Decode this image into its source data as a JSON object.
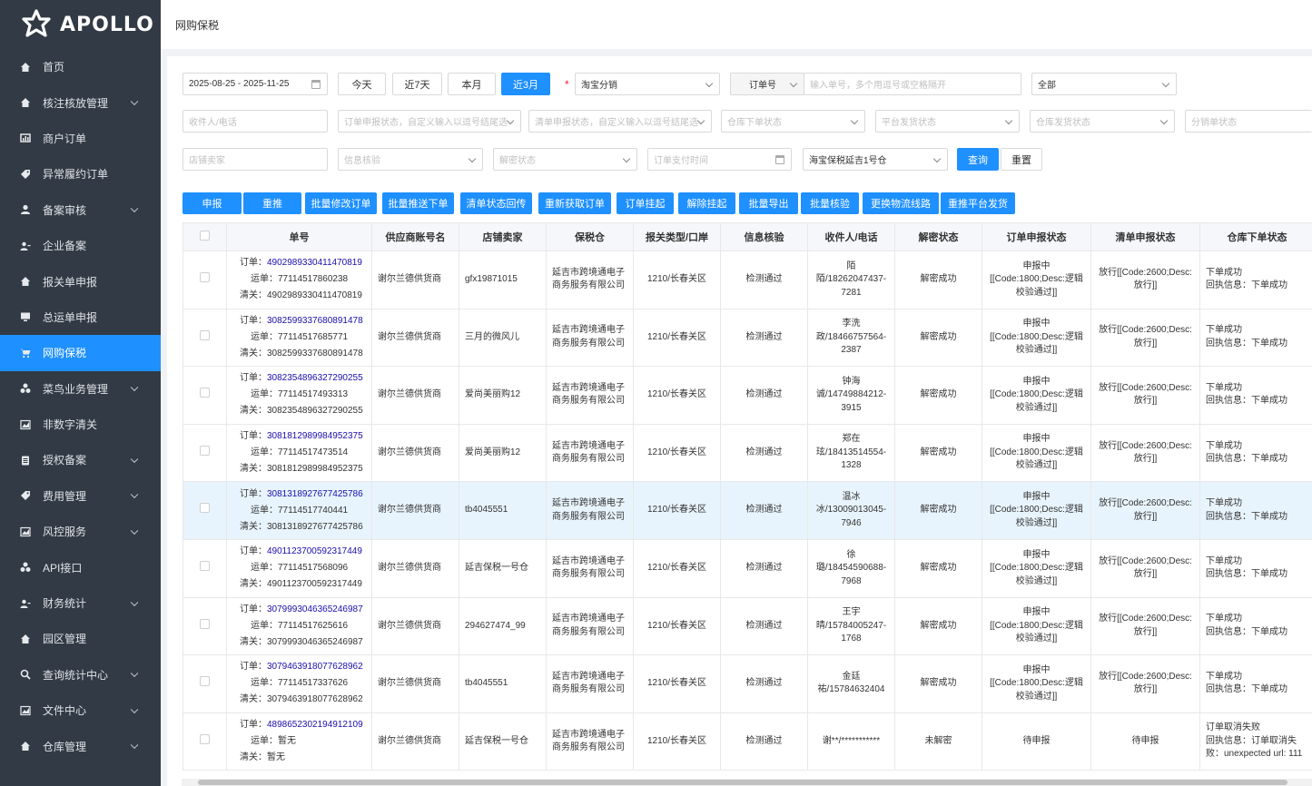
{
  "brand": {
    "name": "APOLLO"
  },
  "sidebar": {
    "items": [
      {
        "label": "首页",
        "icon": "home-icon",
        "arrow": false,
        "active": false
      },
      {
        "label": "核注核放管理",
        "icon": "home-icon",
        "arrow": true,
        "active": false
      },
      {
        "label": "商户订单",
        "icon": "chart-icon",
        "arrow": false,
        "active": false
      },
      {
        "label": "异常履约订单",
        "icon": "tag-icon",
        "arrow": false,
        "active": false
      },
      {
        "label": "备案审核",
        "icon": "user-icon",
        "arrow": true,
        "active": false
      },
      {
        "label": "企业备案",
        "icon": "users-icon",
        "arrow": false,
        "active": false
      },
      {
        "label": "报关单申报",
        "icon": "home-icon",
        "arrow": false,
        "active": false
      },
      {
        "label": "总运单申报",
        "icon": "monitor-icon",
        "arrow": false,
        "active": false
      },
      {
        "label": "网购保税",
        "icon": "cart-icon",
        "arrow": false,
        "active": true
      },
      {
        "label": "菜鸟业务管理",
        "icon": "cubes-icon",
        "arrow": true,
        "active": false
      },
      {
        "label": "非数字清关",
        "icon": "area-chart-icon",
        "arrow": false,
        "active": false
      },
      {
        "label": "授权备案",
        "icon": "clipboard-icon",
        "arrow": true,
        "active": false
      },
      {
        "label": "费用管理",
        "icon": "tag-icon",
        "arrow": true,
        "active": false
      },
      {
        "label": "风控服务",
        "icon": "area-chart-icon",
        "arrow": true,
        "active": false
      },
      {
        "label": "API接口",
        "icon": "cubes-icon",
        "arrow": false,
        "active": false
      },
      {
        "label": "财务统计",
        "icon": "users-icon",
        "arrow": true,
        "active": false
      },
      {
        "label": "园区管理",
        "icon": "home-icon",
        "arrow": false,
        "active": false
      },
      {
        "label": "查询统计中心",
        "icon": "search-icon",
        "arrow": true,
        "active": false
      },
      {
        "label": "文件中心",
        "icon": "area-chart-icon",
        "arrow": true,
        "active": false
      },
      {
        "label": "仓库管理",
        "icon": "home-icon",
        "arrow": true,
        "active": false
      }
    ]
  },
  "header": {
    "title": "网购保税"
  },
  "filters": {
    "date_range": "2025-08-25 - 2025-11-25",
    "quick_dates": [
      "今天",
      "近7天",
      "本月",
      "近3月"
    ],
    "channel": "淘宝分销",
    "order_type": "订单号",
    "order_no_placeholder": "输入单号，多个用逗号或空格隔开",
    "all": "全部",
    "receiver_placeholder": "收件人/电话",
    "order_decl_placeholder": "订单申报状态，自定义输入以逗号结尾选",
    "list_decl_placeholder": "清单申报状态，自定义输入以逗号结尾选",
    "warehouse_order_placeholder": "仓库下单状态",
    "platform_ship_placeholder": "平台发货状态",
    "warehouse_ship_placeholder": "仓库发货状态",
    "split_placeholder": "分销单状态",
    "shop_placeholder": "店铺卖家",
    "info_check_placeholder": "信息核验",
    "decrypt_placeholder": "解密状态",
    "pay_time_placeholder": "订单支付时间",
    "warehouse": "海宝保税延吉1号仓",
    "query": "查询",
    "reset": "重置"
  },
  "actions": [
    "申报",
    "重推",
    "批量修改订单",
    "批量推送下单",
    "清单状态回传",
    "重新获取订单",
    "订单挂起",
    "解除挂起",
    "批量导出",
    "批量核验",
    "更换物流线路",
    "重推平台发货"
  ],
  "table": {
    "columns": [
      "单号",
      "供应商账号名",
      "店铺卖家",
      "保税仓",
      "报关类型/口岸",
      "信息核验",
      "收件人/电话",
      "解密状态",
      "订单申报状态",
      "清单申报状态",
      "仓库下单状态"
    ],
    "rows": [
      {
        "order": "4902989330411470819",
        "waybill": "77114517860238",
        "customs": "4902989330411470819",
        "supplier": "谢尔兰德供货商",
        "shop": "gfx19871015",
        "warehouse": "延吉市跨境通电子商务服务有限公司",
        "decl_type": "1210/长春关区",
        "check": "检测通过",
        "receiver": "陌陌/18262047437-7281",
        "decrypt": "解密成功",
        "order_status": "申报中[[Code:1800;Desc:逻辑校验通过]]",
        "list_status": "放行[[Code:2600;Desc:放行]]",
        "wh_status": "下单成功",
        "wh_info": "回执信息：下单成功"
      },
      {
        "order": "3082599337680891478",
        "waybill": "77114517685771",
        "customs": "3082599337680891478",
        "supplier": "谢尔兰德供货商",
        "shop": "三月的微风儿",
        "warehouse": "延吉市跨境通电子商务服务有限公司",
        "decl_type": "1210/长春关区",
        "check": "检测通过",
        "receiver": "李洗政/18466757564-2387",
        "decrypt": "解密成功",
        "order_status": "申报中[[Code:1800;Desc:逻辑校验通过]]",
        "list_status": "放行[[Code:2600;Desc:放行]]",
        "wh_status": "下单成功",
        "wh_info": "回执信息：下单成功"
      },
      {
        "order": "3082354896327290255",
        "waybill": "77114517493313",
        "customs": "3082354896327290255",
        "supplier": "谢尔兰德供货商",
        "shop": "爱尚美丽购12",
        "warehouse": "延吉市跨境通电子商务服务有限公司",
        "decl_type": "1210/长春关区",
        "check": "检测通过",
        "receiver": "钟海诚/14749884212-3915",
        "decrypt": "解密成功",
        "order_status": "申报中[[Code:1800;Desc:逻辑校验通过]]",
        "list_status": "放行[[Code:2600;Desc:放行]]",
        "wh_status": "下单成功",
        "wh_info": "回执信息：下单成功"
      },
      {
        "order": "3081812989984952375",
        "waybill": "77114517473514",
        "customs": "3081812989984952375",
        "supplier": "谢尔兰德供货商",
        "shop": "爱尚美丽购12",
        "warehouse": "延吉市跨境通电子商务服务有限公司",
        "decl_type": "1210/长春关区",
        "check": "检测通过",
        "receiver": "郑在玹/18413514554-1328",
        "decrypt": "解密成功",
        "order_status": "申报中[[Code:1800;Desc:逻辑校验通过]]",
        "list_status": "放行[[Code:2600;Desc:放行]]",
        "wh_status": "下单成功",
        "wh_info": "回执信息：下单成功"
      },
      {
        "order": "3081318927677425786",
        "waybill": "77114517740441",
        "customs": "3081318927677425786",
        "supplier": "谢尔兰德供货商",
        "shop": "tb4045551",
        "warehouse": "延吉市跨境通电子商务服务有限公司",
        "decl_type": "1210/长春关区",
        "check": "检测通过",
        "receiver": "温冰冰/13009013045-7946",
        "decrypt": "解密成功",
        "order_status": "申报中[[Code:1800;Desc:逻辑校验通过]]",
        "list_status": "放行[[Code:2600;Desc:放行]]",
        "wh_status": "下单成功",
        "wh_info": "回执信息：下单成功"
      },
      {
        "order": "4901123700592317449",
        "waybill": "77114517568096",
        "customs": "4901123700592317449",
        "supplier": "谢尔兰德供货商",
        "shop": "延吉保税一号仓",
        "warehouse": "延吉市跨境通电子商务服务有限公司",
        "decl_type": "1210/长春关区",
        "check": "检测通过",
        "receiver": "徐璐/18454590688-7968",
        "decrypt": "解密成功",
        "order_status": "申报中[[Code:1800;Desc:逻辑校验通过]]",
        "list_status": "放行[[Code:2600;Desc:放行]]",
        "wh_status": "下单成功",
        "wh_info": "回执信息：下单成功"
      },
      {
        "order": "3079993046365246987",
        "waybill": "77114517625616",
        "customs": "3079993046365246987",
        "supplier": "谢尔兰德供货商",
        "shop": "294627474_99",
        "warehouse": "延吉市跨境通电子商务服务有限公司",
        "decl_type": "1210/长春关区",
        "check": "检测通过",
        "receiver": "王宇晴/15784005247-1768",
        "decrypt": "解密成功",
        "order_status": "申报中[[Code:1800;Desc:逻辑校验通过]]",
        "list_status": "放行[[Code:2600;Desc:放行]]",
        "wh_status": "下单成功",
        "wh_info": "回执信息：下单成功"
      },
      {
        "order": "3079463918077628962",
        "waybill": "77114517337626",
        "customs": "3079463918077628962",
        "supplier": "谢尔兰德供货商",
        "shop": "tb4045551",
        "warehouse": "延吉市跨境通电子商务服务有限公司",
        "decl_type": "1210/长春关区",
        "check": "检测通过",
        "receiver": "金廷祐/15784632404",
        "decrypt": "解密成功",
        "order_status": "申报中[[Code:1800;Desc:逻辑校验通过]]",
        "list_status": "放行[[Code:2600;Desc:放行]]",
        "wh_status": "下单成功",
        "wh_info": "回执信息：下单成功"
      },
      {
        "order": "4898652302194912109",
        "waybill": "暂无",
        "customs": "暂无",
        "supplier": "谢尔兰德供货商",
        "shop": "延吉保税一号仓",
        "warehouse": "延吉市跨境通电子商务服务有限公司",
        "decl_type": "1210/长春关区",
        "check": "检测通过",
        "receiver": "谢**/***********",
        "decrypt": "未解密",
        "order_status": "待申报",
        "list_status": "待申报",
        "wh_status": "订单取消失败",
        "wh_info": "回执信息：订单取消失败：unexpected url: 111"
      }
    ],
    "labels": {
      "order": "订单：",
      "waybill": "运单：",
      "customs": "清关："
    }
  }
}
